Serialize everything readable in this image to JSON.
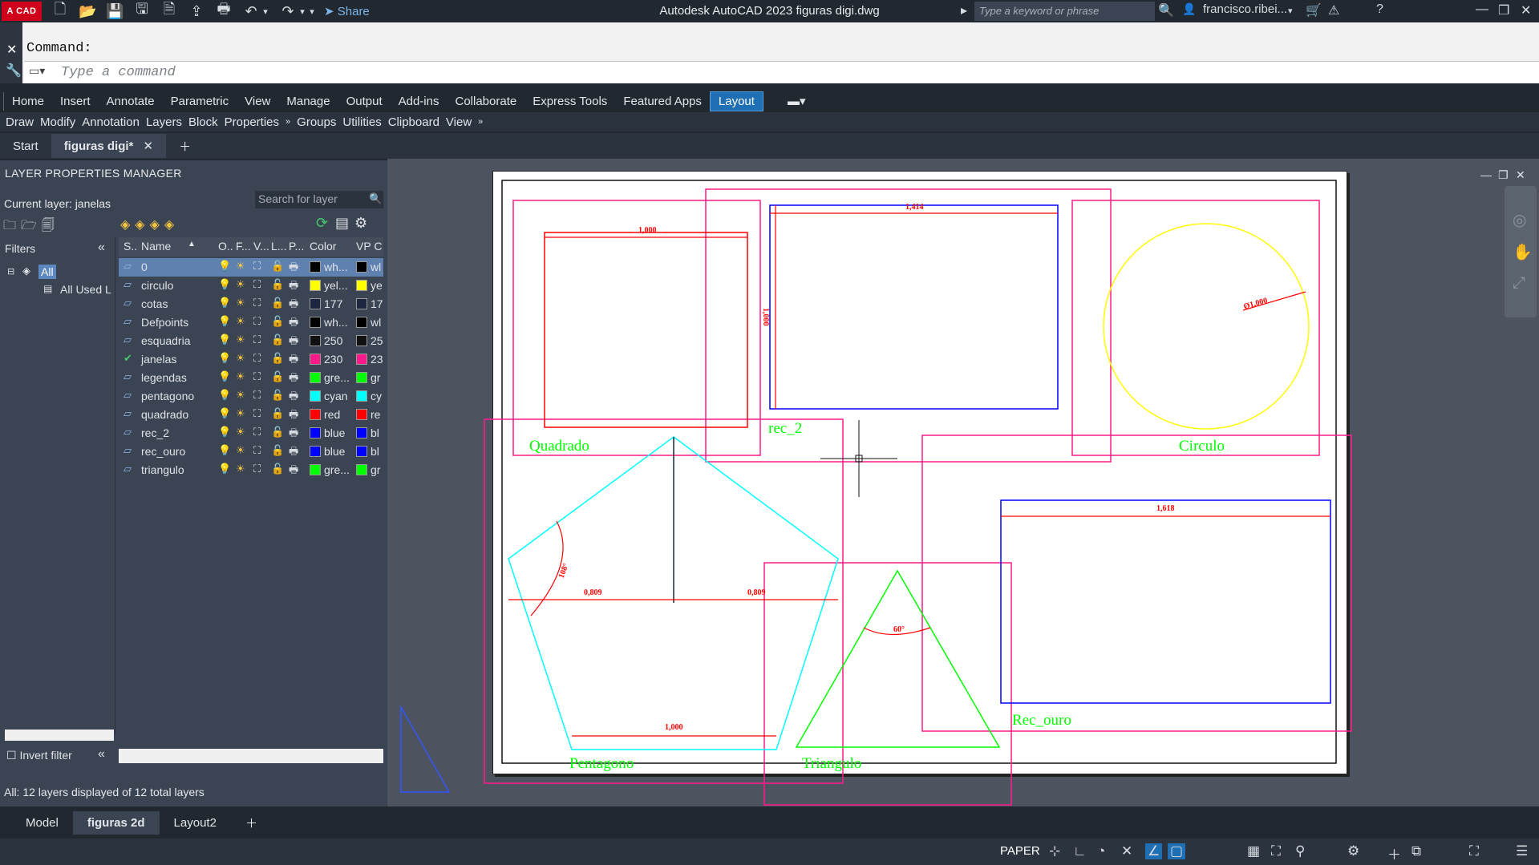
{
  "titlebar": {
    "logo": "A CAD",
    "share": "Share",
    "title": "Autodesk AutoCAD 2023   figuras digi.dwg",
    "search_placeholder": "Type a keyword or phrase",
    "user": "francisco.ribei..."
  },
  "command": {
    "label": "Command:",
    "placeholder": "Type a command"
  },
  "ribbon": {
    "tabs": [
      "Home",
      "Insert",
      "Annotate",
      "Parametric",
      "View",
      "Manage",
      "Output",
      "Add-ins",
      "Collaborate",
      "Express Tools",
      "Featured Apps",
      "Layout"
    ],
    "panels": [
      "Draw",
      "Modify",
      "Annotation",
      "Layers",
      "Block",
      "Properties",
      "»",
      "Groups",
      "Utilities",
      "Clipboard",
      "View",
      "»"
    ]
  },
  "doc_tabs": {
    "start": "Start",
    "active": "figuras digi*"
  },
  "lpm": {
    "title": "LAYER PROPERTIES MANAGER",
    "current_layer": "Current layer: janelas",
    "search_placeholder": "Search for layer",
    "filters_label": "Filters",
    "tree_all": "All",
    "tree_used": "All Used L",
    "invert_filter": "Invert filter",
    "status": "All: 12 layers displayed of 12 total layers",
    "headers": {
      "s": "S..",
      "name": "Name",
      "o": "O..",
      "f": "F...",
      "v": "V...",
      "l": "L...",
      "p": "P...",
      "color": "Color",
      "vpc": "VP C"
    },
    "layers": [
      {
        "name": "0",
        "color": "wh...",
        "vp": "wl",
        "hex": "#000000"
      },
      {
        "name": "circulo",
        "color": "yel...",
        "vp": "ye",
        "hex": "#ffff00"
      },
      {
        "name": "cotas",
        "color": "177",
        "vp": "17",
        "hex": "#1c2640"
      },
      {
        "name": "Defpoints",
        "color": "wh...",
        "vp": "wl",
        "hex": "#000000"
      },
      {
        "name": "esquadria",
        "color": "250",
        "vp": "25",
        "hex": "#111111"
      },
      {
        "name": "janelas",
        "color": "230",
        "vp": "23",
        "hex": "#ff1a8c"
      },
      {
        "name": "legendas",
        "color": "gre...",
        "vp": "gr",
        "hex": "#00ff00"
      },
      {
        "name": "pentagono",
        "color": "cyan",
        "vp": "cy",
        "hex": "#00ffff"
      },
      {
        "name": "quadrado",
        "color": "red",
        "vp": "re",
        "hex": "#ff0000"
      },
      {
        "name": "rec_2",
        "color": "blue",
        "vp": "bl",
        "hex": "#0000ff"
      },
      {
        "name": "rec_ouro",
        "color": "blue",
        "vp": "bl",
        "hex": "#0000ff"
      },
      {
        "name": "triangulo",
        "color": "gre...",
        "vp": "gr",
        "hex": "#00ff00"
      }
    ]
  },
  "drawing": {
    "labels": {
      "quadrado": "Quadrado",
      "rec2": "rec_2",
      "circulo": "Circulo",
      "pentagono": "Pentagono",
      "triangulo": "Triangulo",
      "rec_ouro": "Rec_ouro"
    },
    "dims": {
      "quad": "1,000",
      "rec2_w": "1,414",
      "rec2_h": "1,000",
      "circ": "Ø1,000",
      "pent_l": "0,809",
      "pent_r": "0,809",
      "pent_b": "1,000",
      "pent_a": "108°",
      "tri_a": "60°",
      "ouro": "1,618"
    }
  },
  "bottom_tabs": [
    "Model",
    "figuras 2d",
    "Layout2"
  ],
  "statusbar": {
    "paper": "PAPER"
  }
}
